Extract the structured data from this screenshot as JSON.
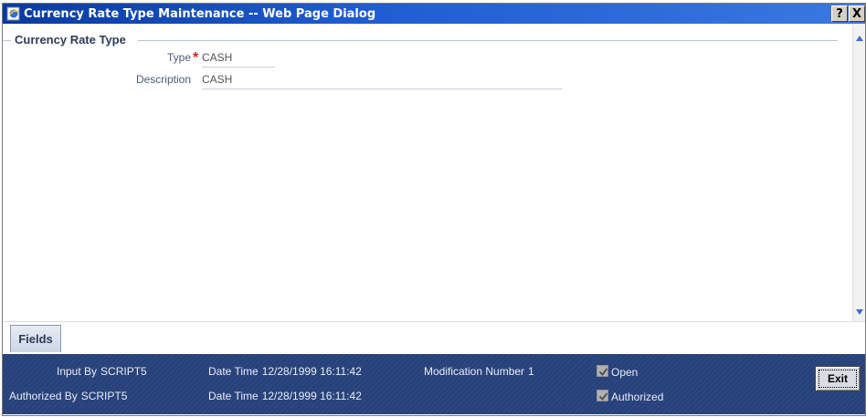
{
  "window": {
    "title": "Currency Rate Type Maintenance -- Web Page Dialog",
    "help_label": "?",
    "close_label": "X"
  },
  "section": {
    "legend": "Currency Rate Type"
  },
  "form": {
    "type_label": "Type",
    "type_required": "*",
    "type_value": "CASH",
    "description_label": "Description",
    "description_value": "CASH"
  },
  "tabs": {
    "fields_label": "Fields"
  },
  "footer": {
    "input_by_label": "Input By",
    "input_by_value": "SCRIPT5",
    "input_datetime_label": "Date Time",
    "input_datetime_value": "12/28/1999 16:11:42",
    "authorized_by_label": "Authorized By",
    "authorized_by_value": "SCRIPT5",
    "auth_datetime_label": "Date Time",
    "auth_datetime_value": "12/28/1999 16:11:42",
    "modification_label": "Modification Number",
    "modification_value": "1",
    "open_label": "Open",
    "open_checked": true,
    "authorized_label": "Authorized",
    "authorized_checked": true,
    "exit_label": "Exit"
  },
  "colors": {
    "titlebar": "#1e5bd1",
    "footer": "#27417a",
    "required": "#d32020",
    "legend": "#2d3b5a"
  }
}
